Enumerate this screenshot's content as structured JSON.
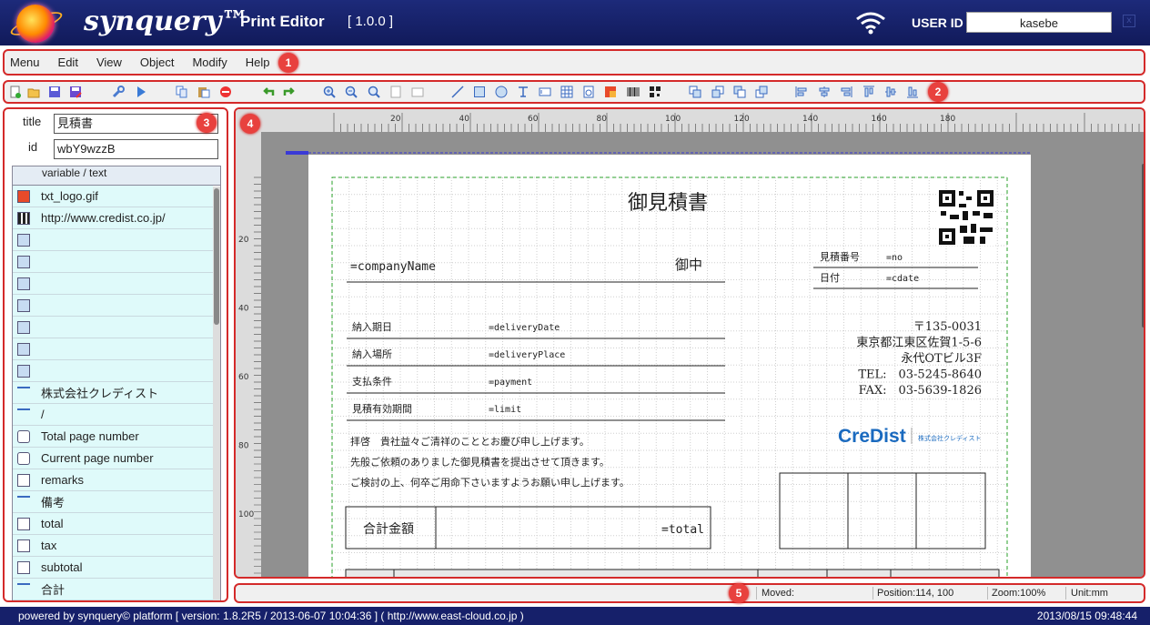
{
  "header": {
    "brand": "synquery™",
    "app_title": "Print Editor",
    "version": "[ 1.0.0 ]",
    "user_id_label": "USER ID",
    "user_id_value": "kasebe",
    "close_label": "x"
  },
  "menu": [
    "Menu",
    "Edit",
    "View",
    "Object",
    "Modify",
    "Help"
  ],
  "toolbar_icons": [
    "new-icon",
    "open-icon",
    "save-icon",
    "save-as-icon",
    "settings-icon",
    "preview-icon",
    "copy-icon",
    "paste-icon",
    "delete-icon",
    "undo-icon",
    "redo-icon",
    "zoom-in-icon",
    "zoom-out-icon",
    "zoom-fit-icon",
    "page-icon",
    "page2-icon",
    "line-icon",
    "rect-icon",
    "circle-icon",
    "text-icon",
    "field-icon",
    "table-icon",
    "pagenum-icon",
    "image-icon",
    "barcode-icon",
    "qrcode-icon",
    "front-icon",
    "forward-icon",
    "backward-icon",
    "back-icon",
    "align-left-icon",
    "align-center-icon",
    "align-right-icon",
    "align-top-icon",
    "align-middle-icon",
    "align-bottom-icon"
  ],
  "markers": [
    "1",
    "2",
    "3",
    "4",
    "5"
  ],
  "props": {
    "title_label": "title",
    "title_value": "見積書",
    "id_label": "id",
    "id_value": "wbY9wzzB"
  },
  "varlist": {
    "header": "variable / text",
    "items": [
      {
        "icon": "image-icon",
        "text": "txt_logo.gif"
      },
      {
        "icon": "qrcode-icon",
        "text": "http://www.credist.co.jp/"
      },
      {
        "icon": "rect-icon",
        "text": ""
      },
      {
        "icon": "rect-icon",
        "text": ""
      },
      {
        "icon": "rect-icon",
        "text": ""
      },
      {
        "icon": "rect-icon",
        "text": ""
      },
      {
        "icon": "rect-icon",
        "text": ""
      },
      {
        "icon": "rect-icon",
        "text": ""
      },
      {
        "icon": "rect-icon",
        "text": ""
      },
      {
        "icon": "text-icon",
        "text": "株式会社クレディスト"
      },
      {
        "icon": "text-icon",
        "text": "/"
      },
      {
        "icon": "pagenum-icon",
        "text": "Total page number"
      },
      {
        "icon": "pagenum-icon",
        "text": "Current page number"
      },
      {
        "icon": "field-icon",
        "text": "remarks"
      },
      {
        "icon": "text-icon",
        "text": "備考"
      },
      {
        "icon": "field-icon",
        "text": "total"
      },
      {
        "icon": "field-icon",
        "text": "tax"
      },
      {
        "icon": "field-icon",
        "text": "subtotal"
      },
      {
        "icon": "text-icon",
        "text": "合計"
      }
    ]
  },
  "ruler": {
    "h": [
      "20",
      "40",
      "60",
      "80",
      "100",
      "120",
      "140",
      "160",
      "180"
    ],
    "v": [
      "20",
      "40",
      "60",
      "80",
      "100"
    ]
  },
  "doc": {
    "title": "御見積書",
    "company": "=companyName",
    "onchu": "御中",
    "est_no_label": "見積番号",
    "est_no": "=no",
    "date_label": "日付",
    "date": "=cdate",
    "rows": [
      {
        "label": "納入期日",
        "value": "=deliveryDate"
      },
      {
        "label": "納入場所",
        "value": "=deliveryPlace"
      },
      {
        "label": "支払条件",
        "value": "=payment"
      },
      {
        "label": "見積有効期間",
        "value": "=limit"
      }
    ],
    "address": [
      "〒135-0031",
      "東京都江東区佐賀1-5-6",
      "永代OTビル3F",
      "TEL:　03-5245-8640",
      "FAX:　03-5639-1826"
    ],
    "greeting": [
      "拝啓　貴社益々ご清祥のこととお慶び申し上げます。",
      "先般ご依頼のありました御見積書を提出させて頂きます。",
      "ご検討の上、何卒ご用命下さいますようお願い申し上げます。"
    ],
    "logo_text": "CreDist",
    "logo_sub": "株式会社クレディスト",
    "total_label": "合計金額",
    "total_value": "=total"
  },
  "status": {
    "moved": "Moved:",
    "position": "Position:114, 100",
    "zoom": "Zoom:100%",
    "unit": "Unit:mm"
  },
  "footer": {
    "left": "powered by synquery© platform [ version: 1.8.2R5 / 2013-06-07 10:04:36 ] ( http://www.east-cloud.co.jp )",
    "right": "2013/08/15 09:48:44"
  },
  "colors": {
    "header": "#16206a",
    "highlight": "#d42a2a",
    "row": "#dffafa"
  }
}
